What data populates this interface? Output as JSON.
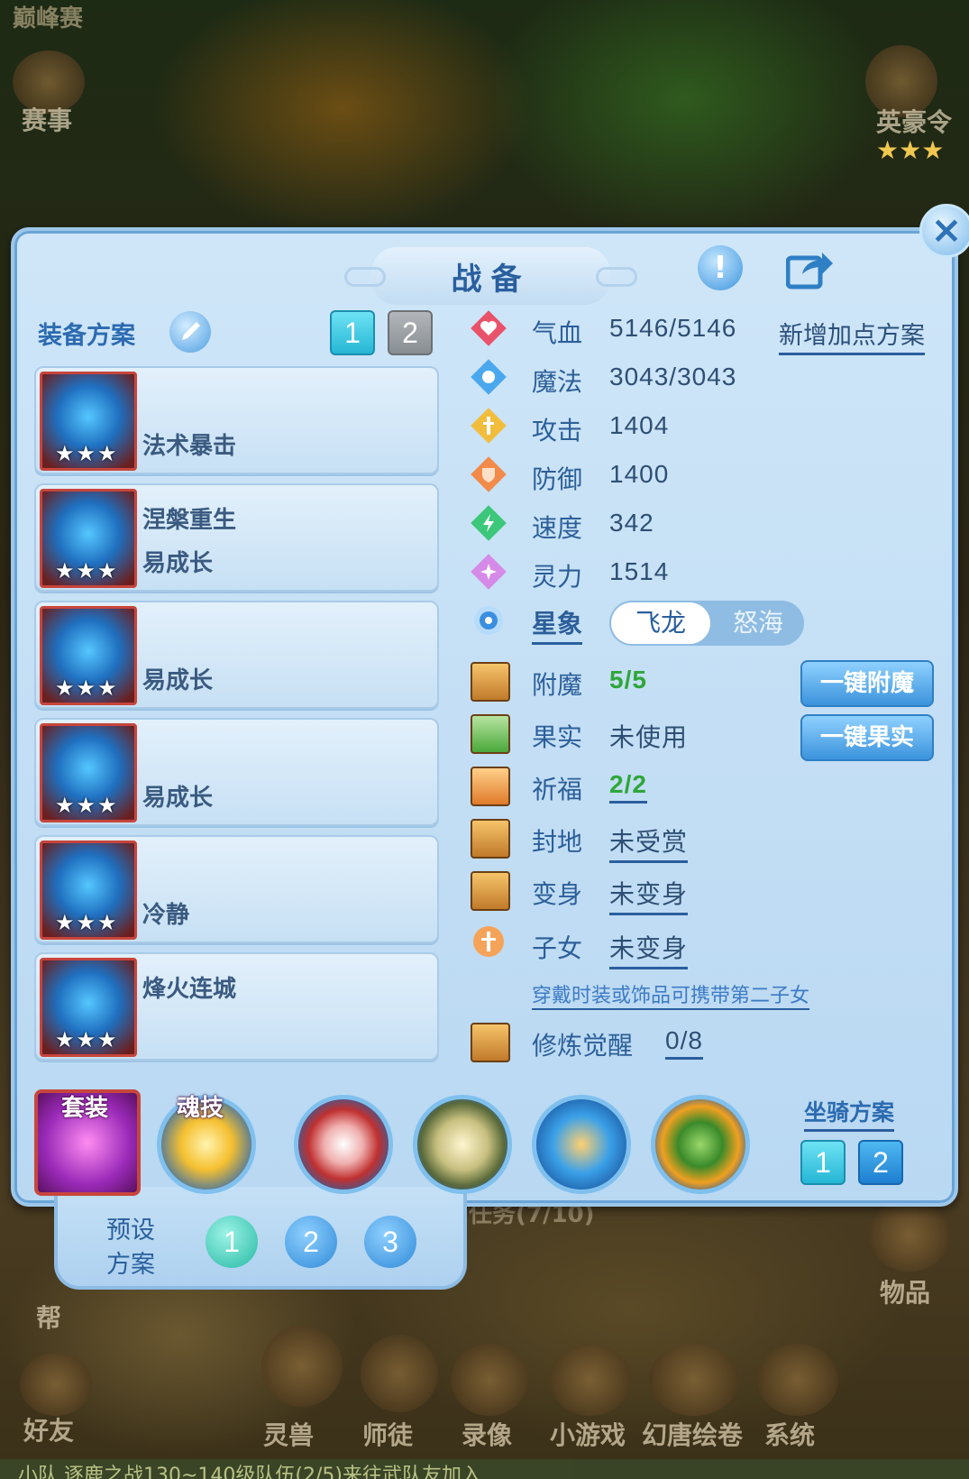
{
  "background": {
    "top_left_label": "巅峰赛",
    "event_label": "赛事",
    "top_right_label": "英豪令",
    "top_right_stars": "★★★",
    "left_help": "帮",
    "right_items": "物品",
    "bottom_task": "任务(7/10)",
    "bottom_nav": [
      "好友",
      "灵兽",
      "师徒",
      "录像",
      "小游戏",
      "幻唐绘卷",
      "系统"
    ],
    "ticker": "小队 逐鹿之战130~140级队伍(2/5)来往武队友加入"
  },
  "header": {
    "title": "战备",
    "close_icon": "×",
    "info_icon": "!"
  },
  "equip": {
    "label": "装备方案",
    "plans": [
      "1",
      "2"
    ],
    "slots": [
      {
        "line1": "",
        "line2": "法术暴击",
        "stars": "★★★",
        "icon": "weapon-icon"
      },
      {
        "line1": "涅槃重生",
        "line2": "易成长",
        "stars": "★★★",
        "icon": "helmet-icon"
      },
      {
        "line1": "",
        "line2": "易成长",
        "stars": "★★★",
        "icon": "armor-icon"
      },
      {
        "line1": "",
        "line2": "易成长",
        "stars": "★★★",
        "icon": "necklace-icon"
      },
      {
        "line1": "",
        "line2": "冷静",
        "stars": "★★★",
        "icon": "belt-icon"
      },
      {
        "line1": "烽火连城",
        "line2": "",
        "stars": "★★★",
        "icon": "boots-icon"
      }
    ]
  },
  "stats": [
    {
      "label": "气血",
      "value": "5146/5146",
      "icon": "heart-icon",
      "color": "#e9536a"
    },
    {
      "label": "魔法",
      "value": "3043/3043",
      "icon": "mana-icon",
      "color": "#4aa8ee"
    },
    {
      "label": "攻击",
      "value": "1404",
      "icon": "sword-icon",
      "color": "#f2bd3c"
    },
    {
      "label": "防御",
      "value": "1400",
      "icon": "shield-icon",
      "color": "#f28a4a"
    },
    {
      "label": "速度",
      "value": "342",
      "icon": "lightning-icon",
      "color": "#3cc77a"
    },
    {
      "label": "灵力",
      "value": "1514",
      "icon": "spirit-icon",
      "color": "#d68ae8"
    }
  ],
  "add_plan_link": "新增加点方案",
  "constellation": {
    "label": "星象",
    "options": [
      "飞龙",
      "怒海"
    ],
    "selected": "飞龙"
  },
  "extras": [
    {
      "label": "附魔",
      "value": "5/5",
      "icon": "enchant-icon"
    },
    {
      "label": "果实",
      "value": "未使用",
      "icon": "fruit-icon"
    },
    {
      "label": "祈福",
      "value": "2/2",
      "icon": "blessing-icon"
    },
    {
      "label": "封地",
      "value": "未受赏",
      "icon": "fief-icon"
    },
    {
      "label": "变身",
      "value": "未变身",
      "icon": "transform-icon"
    },
    {
      "label": "子女",
      "value": "未变身",
      "icon": "children-icon"
    }
  ],
  "children_hint": "穿戴时装或饰品可携带第二子女",
  "awaken": {
    "label": "修炼觉醒",
    "value": "0/8"
  },
  "buttons": {
    "enchant_all": "一键附魔",
    "fruit_all": "一键果实"
  },
  "bottom": {
    "suit": "套装",
    "soul_skill": "魂技",
    "mount_label": "坐骑方案",
    "mount_plans": [
      "1",
      "2"
    ],
    "preset_label_1": "预设",
    "preset_label_2": "方案",
    "presets": [
      "1",
      "2",
      "3"
    ]
  }
}
